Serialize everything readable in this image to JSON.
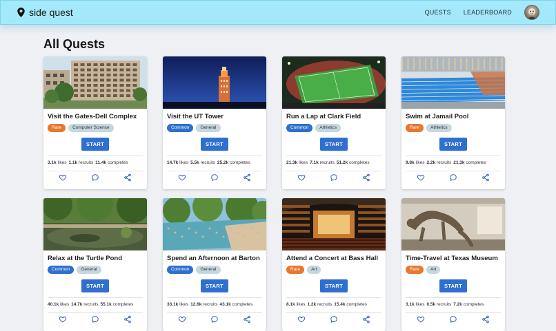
{
  "nav": {
    "brand": "side quest",
    "links": [
      "QUESTS",
      "LEADERBOARD"
    ]
  },
  "page": {
    "title": "All Quests"
  },
  "colors": {
    "navbar": "#a4e9fb",
    "rare": "#e8772e",
    "common": "#2f6fd0",
    "tag_category": "#c5d7df",
    "start_button": "#2f6fd0"
  },
  "labels": {
    "start": "START",
    "likes": "likes",
    "recruits": "recruits",
    "completes": "completes"
  },
  "quests": [
    {
      "title": "Visit the Gates-Dell Complex",
      "rarity": "Rare",
      "category": "Computer Science",
      "likes": "3.1k",
      "recruits": "1.1k",
      "completes": "11.4k",
      "image": "building"
    },
    {
      "title": "Visit the UT Tower",
      "rarity": "Common",
      "category": "General",
      "likes": "14.7k",
      "recruits": "5.5k",
      "completes": "25.2k",
      "image": "tower-night"
    },
    {
      "title": "Run a Lap at Clark Field",
      "rarity": "Common",
      "category": "Athletics",
      "likes": "21.3k",
      "recruits": "7.1k",
      "completes": "51.2k",
      "image": "field"
    },
    {
      "title": "Swim at Jamail Pool",
      "rarity": "Rare",
      "category": "Athletics",
      "likes": "9.8k",
      "recruits": "2.2k",
      "completes": "21.3k",
      "image": "pool"
    },
    {
      "title": "Relax at the Turtle Pond",
      "rarity": "Common",
      "category": "General",
      "likes": "40.1k",
      "recruits": "14.7k",
      "completes": "55.1k",
      "image": "pond"
    },
    {
      "title": "Spend an Afternoon at Barton",
      "rarity": "Common",
      "category": "General",
      "likes": "33.1k",
      "recruits": "12.6k",
      "completes": "43.1k",
      "image": "springs"
    },
    {
      "title": "Attend a Concert at Bass Hall",
      "rarity": "Rare",
      "category": "Art",
      "likes": "8.1k",
      "recruits": "1.2k",
      "completes": "15.4k",
      "image": "concert-hall"
    },
    {
      "title": "Time-Travel at Texas Museum",
      "rarity": "Rare",
      "category": "Art",
      "likes": "3.1k",
      "recruits": "0.5k",
      "completes": "7.2k",
      "image": "museum"
    }
  ]
}
